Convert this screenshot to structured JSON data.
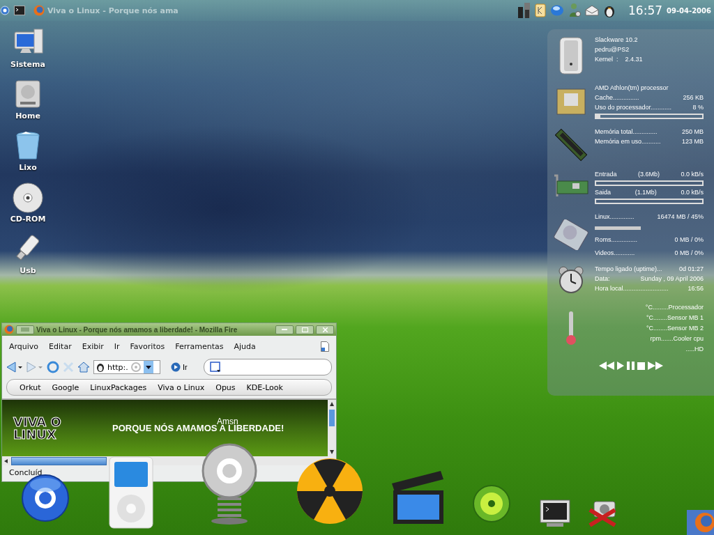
{
  "taskbar": {
    "tasks": [
      {
        "title": "Viva o Linux - Porque nós ama",
        "selected": false
      }
    ],
    "clock": "16:57",
    "date": "09-04-2006"
  },
  "desktop_icons": [
    {
      "label": "Sistema"
    },
    {
      "label": "Home"
    },
    {
      "label": "Lixo"
    },
    {
      "label": "CD-ROM"
    },
    {
      "label": "Usb"
    }
  ],
  "system_monitor": {
    "sections": [
      {
        "rows": [
          {
            "kind": "line",
            "text": "Slackware 10.2"
          },
          {
            "kind": "line",
            "text": "pedru@PS2"
          },
          {
            "kind": "line",
            "text": "Kernel  :    2.4.31"
          }
        ]
      },
      {
        "rows": [
          {
            "kind": "line",
            "text": "AMD Athlon(tm) processor"
          },
          {
            "kind": "pair",
            "label": "Cache...............",
            "value": "256 KB"
          },
          {
            "kind": "pair",
            "label": "Uso do processador............",
            "value": "8 %"
          },
          {
            "kind": "bar",
            "level": 0.04
          }
        ]
      },
      {
        "rows": [
          {
            "kind": "pair",
            "label": "Memória total..............",
            "value": "250 MB"
          },
          {
            "kind": "pair",
            "label": "Memória em uso...........",
            "value": "123 MB"
          }
        ]
      },
      {
        "rows": [
          {
            "kind": "triple",
            "label": "Entrada",
            "note": "(3.6Mb)",
            "value": "0.0 kB/s"
          },
          {
            "kind": "bar",
            "level": 0
          },
          {
            "kind": "triple",
            "label": "Saida",
            "note": "(1.1Mb)",
            "value": "0.0 kB/s"
          },
          {
            "kind": "bar",
            "level": 0
          }
        ]
      },
      {
        "rows": [
          {
            "kind": "pair",
            "label": "Linux..............",
            "value": "16474 MB / 45%"
          },
          {
            "kind": "meter",
            "level": 0.42
          },
          {
            "kind": "pair",
            "label": "Roms...............",
            "value": "0 MB / 0%"
          },
          {
            "kind": "pair",
            "label": "Videos............",
            "value": "0 MB / 0%"
          }
        ]
      },
      {
        "rows": [
          {
            "kind": "pair",
            "label": "Tempo ligado (uptime)...",
            "value": "0d 01:27"
          },
          {
            "kind": "pair",
            "label": "Data:",
            "value": "Sunday , 09 April 2006"
          },
          {
            "kind": "pair",
            "label": "Hora local..........................",
            "value": "16:56"
          }
        ]
      },
      {
        "rows": [
          {
            "kind": "right",
            "text": "°C.........Processador"
          },
          {
            "kind": "right",
            "text": "°C........Sensor MB 1"
          },
          {
            "kind": "right",
            "text": "°C........Sensor MB 2"
          },
          {
            "kind": "right",
            "text": "rpm.......Cooler cpu"
          },
          {
            "kind": "right",
            "text": ".....HD"
          }
        ]
      }
    ]
  },
  "browser": {
    "title": "Viva o Linux - Porque nós amamos a liberdade! - Mozilla Fire",
    "menus": [
      "Arquivo",
      "Editar",
      "Exibir",
      "Ir",
      "Favoritos",
      "Ferramentas",
      "Ajuda"
    ],
    "url": "http:.",
    "go": "Ir",
    "bookmarks": [
      "Orkut",
      "Google",
      "LinuxPackages",
      "Viva o Linux",
      "Opus",
      "KDE-Look"
    ],
    "page": {
      "logo": "VIVA O LINUX",
      "slogan": "PORQUE NÓS AMAMOS A LIBERDADE!"
    },
    "status": "Concluíd"
  },
  "dock": {
    "tooltip": "Amsn"
  }
}
